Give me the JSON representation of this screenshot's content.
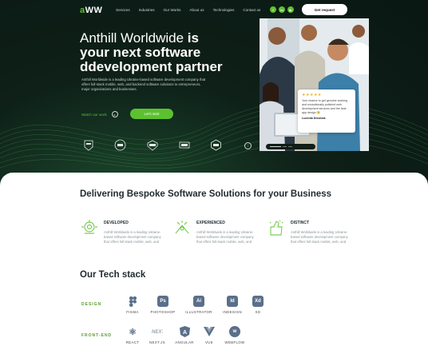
{
  "header": {
    "logo_prefix": "a",
    "logo_rest": "WW",
    "nav": [
      "Services",
      "Industries",
      "Our Works",
      "About us",
      "Technologies",
      "Contact us"
    ],
    "social": [
      "f",
      "in",
      "▶"
    ],
    "cta_label": "Get request"
  },
  "hero": {
    "title_normal": "Anthill Worldwide ",
    "title_bold1": "is",
    "title_line2": "your next software",
    "title_line3": "ddevelopment partner",
    "intro": "Anthill Worldwide is a leading Ukraine-based software development company that offers full-stack mobile, web, and backend software solutions to entrepreneurs, major organizations and businesses.",
    "watch_label": "Watch our work",
    "start_label": "Let's start"
  },
  "review": {
    "stars": "★★★★★",
    "quote": "Your chance to get genuine working and exceptionally polished web development services and the best app design 🙂",
    "author": "Lucinda Dissilola"
  },
  "delivering": {
    "title_prefix": "Delivering Bespoke ",
    "title_bold": "Software Solutions",
    "title_suffix": " for your Business",
    "features": [
      {
        "title": "DEVELOPED",
        "desc": "Anthill Worldwide is a leading Ukraine-based software development company that offers full-stack mobile, web, and"
      },
      {
        "title": "EXPERIENCED",
        "desc": "Anthill Worldwide is a leading Ukraine-based software development company that offers full-stack mobile, web, and"
      },
      {
        "title": "DISTINCT",
        "desc": "Anthill Worldwide is a leading Ukraine-based software development company that offers full-stack mobile, web, and"
      }
    ]
  },
  "tech": {
    "title_prefix": "Our ",
    "title_bold": "Tech stack",
    "design_label": "DESIGN",
    "frontend_label": "FRONT-END",
    "design": [
      {
        "label": "FIGMA",
        "glyph": "",
        "color": "#5a6f8a"
      },
      {
        "label": "PHOTOSHOP",
        "glyph": "Ps",
        "color": "#5a6f8a"
      },
      {
        "label": "ILLUSTRATOR",
        "glyph": "Ai",
        "color": "#5a6f8a"
      },
      {
        "label": "INDESIGN",
        "glyph": "Id",
        "color": "#5a6f8a"
      },
      {
        "label": "XD",
        "glyph": "Xd",
        "color": "#5a6f8a"
      }
    ],
    "frontend": [
      {
        "label": "REACT",
        "glyph": "⚛",
        "color": "#5a6f8a"
      },
      {
        "label": "NEXT.JS",
        "glyph": "",
        "color": "#5a6f8a"
      },
      {
        "label": "ANGULAR",
        "glyph": "A",
        "color": "#5a6f8a"
      },
      {
        "label": "VUE",
        "glyph": "V",
        "color": "#5a6f8a"
      },
      {
        "label": "WEBFLOW",
        "glyph": "w",
        "color": "#5a6f8a"
      }
    ]
  },
  "colors": {
    "accent": "#5cc12e",
    "dark": "#0e2018"
  }
}
